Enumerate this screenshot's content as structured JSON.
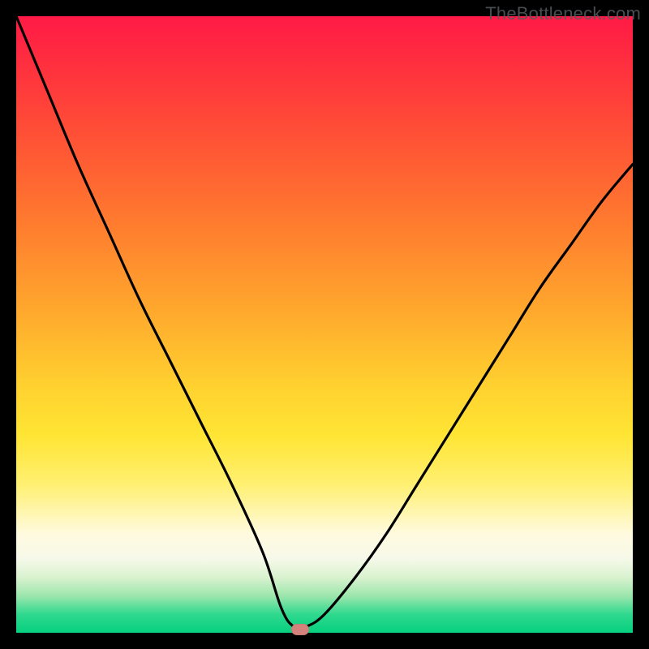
{
  "watermark": {
    "text": "TheBottleneck.com"
  },
  "chart_data": {
    "type": "line",
    "title": "",
    "xlabel": "",
    "ylabel": "",
    "xlim": [
      0,
      100
    ],
    "ylim": [
      0,
      100
    ],
    "grid": false,
    "legend": false,
    "series": [
      {
        "name": "bottleneck-curve",
        "x": [
          0,
          5,
          10,
          15,
          20,
          25,
          30,
          35,
          40,
          43,
          45,
          47,
          50,
          55,
          60,
          65,
          70,
          75,
          80,
          85,
          90,
          95,
          100
        ],
        "y": [
          100,
          88,
          76,
          65,
          54,
          44,
          34,
          24,
          13,
          4,
          1,
          1,
          3,
          9,
          16,
          24,
          32,
          40,
          48,
          56,
          63,
          70,
          76
        ]
      }
    ],
    "marker": {
      "x": 46,
      "y": 0.5
    },
    "background_gradient": {
      "top_color": "#ff1a46",
      "bottom_color": "#06cf7f"
    }
  }
}
